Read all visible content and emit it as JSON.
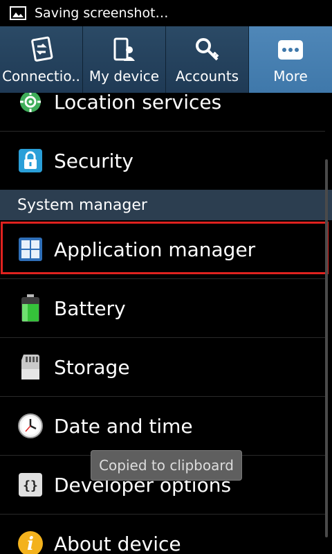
{
  "status_bar": {
    "notification_text": "Saving screenshot…"
  },
  "tabs": [
    {
      "label": "Connectio..",
      "icon": "connections-icon",
      "active": false
    },
    {
      "label": "My device",
      "icon": "my-device-icon",
      "active": false
    },
    {
      "label": "Accounts",
      "icon": "accounts-icon",
      "active": false
    },
    {
      "label": "More",
      "icon": "more-icon",
      "active": true
    }
  ],
  "list": {
    "items": [
      {
        "label": "Location services",
        "icon": "location-icon"
      },
      {
        "label": "Security",
        "icon": "lock-icon"
      }
    ],
    "section_header": "System manager",
    "system_items": [
      {
        "label": "Application manager",
        "icon": "apps-grid-icon",
        "highlighted": true
      },
      {
        "label": "Battery",
        "icon": "battery-icon"
      },
      {
        "label": "Storage",
        "icon": "sd-card-icon"
      },
      {
        "label": "Date and time",
        "icon": "clock-icon"
      },
      {
        "label": "Developer options",
        "icon": "braces-icon"
      },
      {
        "label": "About device",
        "icon": "info-icon"
      }
    ]
  },
  "toast": {
    "text": "Copied to clipboard"
  },
  "colors": {
    "tab_bar": "#1f3a55",
    "tab_active": "#4f87b8",
    "section_header": "#2c3e50",
    "highlight": "#e0221f"
  }
}
